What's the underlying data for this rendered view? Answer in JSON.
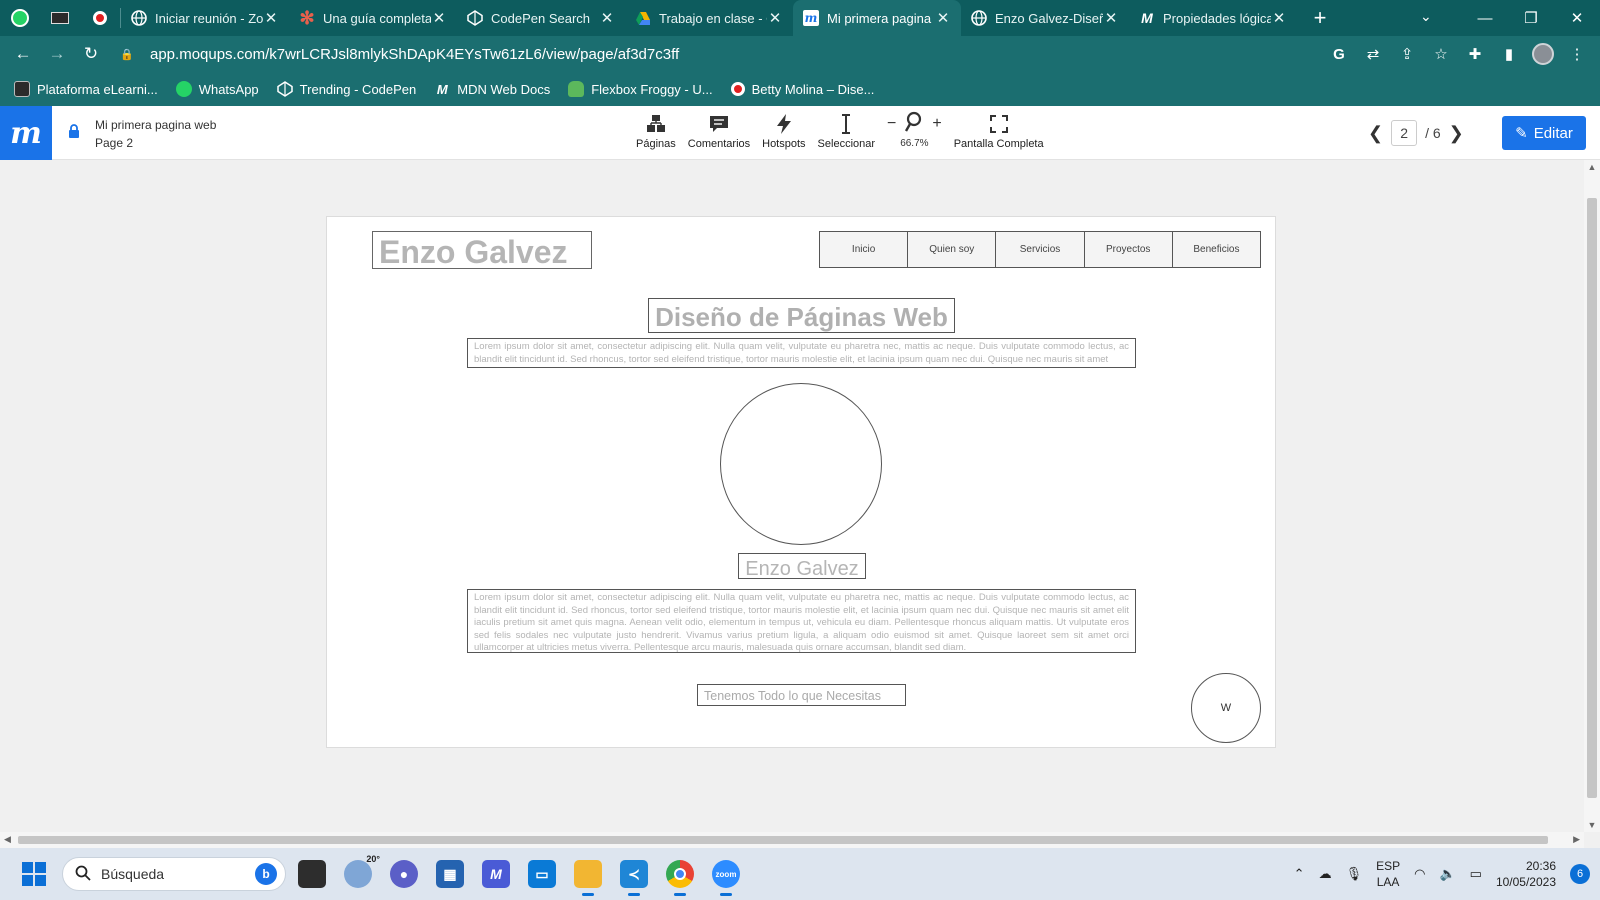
{
  "browser": {
    "pinned_tabs": [
      {
        "icon": "whatsapp-icon"
      },
      {
        "icon": "elearning-icon"
      },
      {
        "icon": "record-icon"
      }
    ],
    "tabs": [
      {
        "title": "Iniciar reunión - Zo",
        "icon": "globe-icon",
        "active": false
      },
      {
        "title": "Una guía completa",
        "icon": "asterisk-icon",
        "active": false
      },
      {
        "title": "CodePen Search",
        "icon": "codepen-icon",
        "active": false
      },
      {
        "title": "Trabajo en clase - C",
        "icon": "drive-icon",
        "active": false
      },
      {
        "title": "Mi primera pagina",
        "icon": "moqups-icon",
        "active": true
      },
      {
        "title": "Enzo Galvez-Diseñ",
        "icon": "globe-icon",
        "active": false
      },
      {
        "title": "Propiedades lógica",
        "icon": "mdn-icon",
        "active": false
      }
    ],
    "url": "app.moqups.com/k7wrLCRJsl8mlykShDApK4EYsTw61zL6/view/page/af3d7c3ff",
    "bookmarks": [
      {
        "label": "Plataforma eLearni...",
        "icon": "elearning-icon",
        "color": "#2b2b2b"
      },
      {
        "label": "WhatsApp",
        "icon": "whatsapp-icon",
        "color": "#25d366"
      },
      {
        "label": "Trending - CodePen",
        "icon": "codepen-icon",
        "color": "#1b6e70"
      },
      {
        "label": "MDN Web Docs",
        "icon": "mdn-icon",
        "color": "#1b6e70"
      },
      {
        "label": "Flexbox Froggy - U...",
        "icon": "frog-icon",
        "color": "#5cb85c"
      },
      {
        "label": "Betty Molina – Dise...",
        "icon": "record-icon",
        "color": "#e02020"
      }
    ]
  },
  "moqups": {
    "logo": "m",
    "project_name": "Mi primera pagina web",
    "page_name": "Page 2",
    "tools": [
      {
        "label": "Páginas",
        "icon": "pages-icon"
      },
      {
        "label": "Comentarios",
        "icon": "comments-icon"
      },
      {
        "label": "Hotspots",
        "icon": "hotspots-icon"
      },
      {
        "label": "Seleccionar",
        "icon": "select-text-icon"
      }
    ],
    "zoom": {
      "value": "66.7%",
      "minus": "−",
      "plus": "+"
    },
    "fullscreen_label": "Pantalla Completa",
    "page_current": "2",
    "page_total": "/ 6",
    "edit_label": "Editar",
    "accent": "#1a73e8"
  },
  "wireframe": {
    "logo_text": "Enzo Galvez",
    "nav": [
      "Inicio",
      "Quien soy",
      "Servicios",
      "Proyectos",
      "Beneficios"
    ],
    "heading": "Diseño de Páginas Web",
    "paragraph1": "Lorem ipsum dolor sit amet, consectetur adipiscing elit. Nulla quam velit, vulputate eu pharetra nec, mattis ac neque. Duis vulputate commodo lectus, ac blandit elit tincidunt id. Sed rhoncus, tortor sed eleifend tristique, tortor mauris molestie elit, et lacinia ipsum quam nec dui. Quisque nec mauris sit amet",
    "name": "Enzo Galvez",
    "paragraph2": "Lorem ipsum dolor sit amet, consectetur adipiscing elit. Nulla quam velit, vulputate eu pharetra nec, mattis ac neque. Duis vulputate commodo lectus, ac blandit elit tincidunt id. Sed rhoncus, tortor sed eleifend tristique, tortor mauris molestie elit, et lacinia ipsum quam nec dui. Quisque nec mauris sit amet elit iaculis pretium sit amet quis magna. Aenean velit odio, elementum in tempus ut, vehicula eu diam. Pellentesque rhoncus aliquam mattis. Ut vulputate eros sed felis sodales nec vulputate justo hendrerit. Vivamus varius pretium ligula, a aliquam odio euismod sit amet. Quisque laoreet sem sit amet orci ullamcorper at ultricies metus viverra. Pellentesque arcu mauris, malesuada quis ornare accumsan, blandit sed diam.",
    "slogan": "Tenemos Todo lo que Necesitas",
    "circle_label": "W"
  },
  "taskbar": {
    "search_placeholder": "Búsqueda",
    "weather_temp": "20°",
    "apps": [
      {
        "name": "file-manager",
        "icon": "folder-dark-icon",
        "color": "#2d2d2d"
      },
      {
        "name": "weather",
        "icon": "weather-icon",
        "color": "#7fa6d6"
      },
      {
        "name": "chat",
        "icon": "chat-icon",
        "color": "#5b5fc7"
      },
      {
        "name": "store",
        "icon": "store-icon",
        "color": "#2563b0"
      },
      {
        "name": "moqups-app",
        "icon": "moqups-icon",
        "color": "#4a5bd6"
      },
      {
        "name": "desktop",
        "icon": "monitor-icon",
        "color": "#0a7ad6"
      },
      {
        "name": "explorer",
        "icon": "folder-icon",
        "color": "#f2b632"
      },
      {
        "name": "vscode",
        "icon": "vscode-icon",
        "color": "#1f86d6"
      },
      {
        "name": "chrome",
        "icon": "chrome-icon",
        "color": "#e94235"
      },
      {
        "name": "zoom",
        "icon": "zoom-icon",
        "color": "#2d8cff"
      }
    ],
    "lang_top": "ESP",
    "lang_bottom": "LAA",
    "time": "20:36",
    "date": "10/05/2023",
    "notifications": "6"
  }
}
